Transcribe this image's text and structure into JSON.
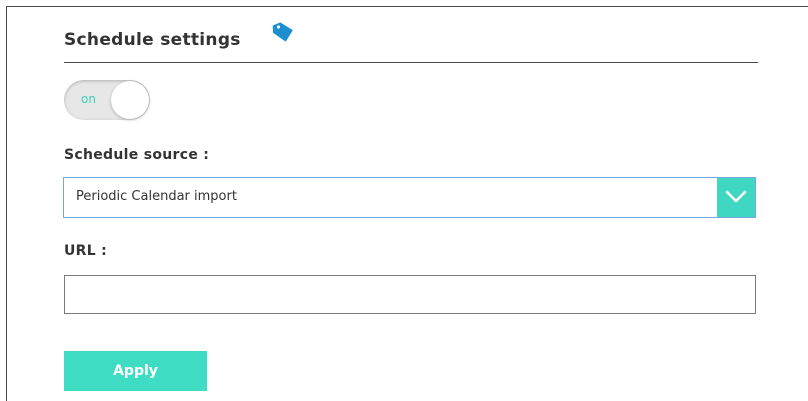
{
  "header": {
    "title": "Schedule settings",
    "icon": "tag-icon",
    "icon_color": "#1c8fd1"
  },
  "toggle": {
    "label": "on",
    "state": "on",
    "accent_color": "#3fd0b8"
  },
  "schedule_source": {
    "label": "Schedule source :",
    "selected": "Periodic Calendar import",
    "arrow_icon": "chevron-down-icon",
    "arrow_color": "#3fd6c2"
  },
  "url": {
    "label": "URL :",
    "value": ""
  },
  "apply": {
    "label": "Apply",
    "color": "#3fdcc4"
  }
}
